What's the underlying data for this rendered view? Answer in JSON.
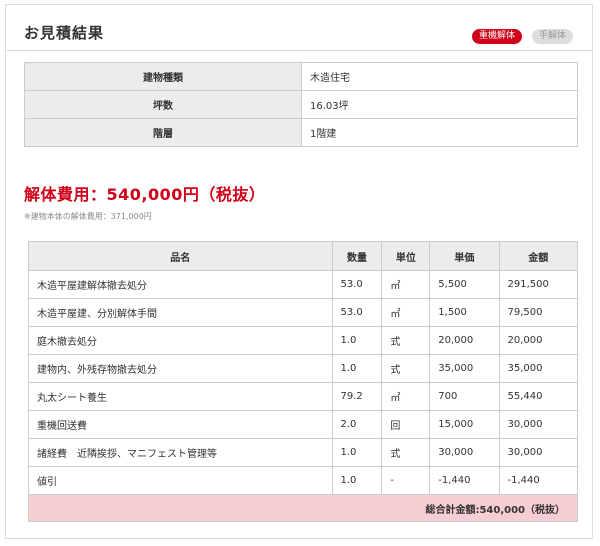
{
  "header": {
    "title": "お見積結果",
    "badges": {
      "active": "重機解体",
      "inactive": "手解体"
    }
  },
  "info": {
    "rows": [
      {
        "label": "建物種類",
        "value": "木造住宅"
      },
      {
        "label": "坪数",
        "value": "16.03坪"
      },
      {
        "label": "階層",
        "value": "1階建"
      }
    ]
  },
  "price": {
    "headline": "解体費用：540,000円（税抜）",
    "note": "※建物本体の解体費用：371,000円"
  },
  "items": {
    "headers": [
      "品名",
      "数量",
      "単位",
      "単価",
      "金額"
    ],
    "rows": [
      [
        "木造平屋建解体撤去処分",
        "53.0",
        "㎡",
        "5,500",
        "291,500"
      ],
      [
        "木造平屋建、分別解体手間",
        "53.0",
        "㎡",
        "1,500",
        "79,500"
      ],
      [
        "庭木撤去処分",
        "1.0",
        "式",
        "20,000",
        "20,000"
      ],
      [
        "建物内、外残存物撤去処分",
        "1.0",
        "式",
        "35,000",
        "35,000"
      ],
      [
        "丸太シート養生",
        "79.2",
        "㎡",
        "700",
        "55,440"
      ],
      [
        "重機回送費",
        "2.0",
        "回",
        "15,000",
        "30,000"
      ],
      [
        "諸経費　近隣挨拶、マニフェスト管理等",
        "1.0",
        "式",
        "30,000",
        "30,000"
      ],
      [
        "値引",
        "1.0",
        "-",
        "-1,440",
        "-1,440"
      ]
    ],
    "total": "総合計金額:540,000（税抜）"
  },
  "colors": {
    "accent": "#d00018",
    "header_bg": "#ececec",
    "total_bg": "#f7cdd4"
  }
}
